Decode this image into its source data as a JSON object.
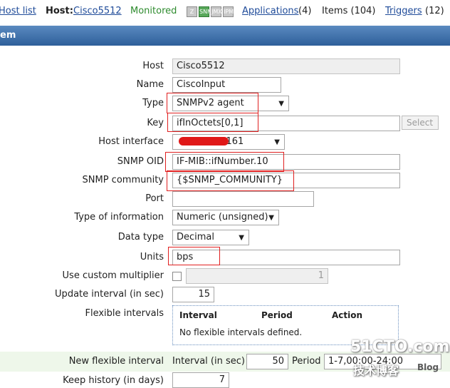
{
  "nav": {
    "host_list": "Host list",
    "host_label": "Host:",
    "host_name": "Cisco5512",
    "status": "Monitored",
    "status_icons": [
      "Z",
      "SNMP",
      "JMX",
      "IPMI"
    ],
    "applications_label": "Applications",
    "applications_count": "(4)",
    "items_label": "Items (104)",
    "triggers_label": "Triggers",
    "triggers_count": "(12)"
  },
  "title": "em",
  "form": {
    "host": {
      "label": "Host",
      "value": "Cisco5512"
    },
    "name": {
      "label": "Name",
      "value": "CiscoInput"
    },
    "type": {
      "label": "Type",
      "value": "SNMPv2 agent"
    },
    "key": {
      "label": "Key",
      "value": "ifInOctets[0,1]",
      "select_button": "Select"
    },
    "host_interface": {
      "label": "Host interface",
      "value": ": 161"
    },
    "snmp_oid": {
      "label": "SNMP OID",
      "value": "IF-MIB::ifNumber.10"
    },
    "snmp_community": {
      "label": "SNMP community",
      "value": "{$SNMP_COMMUNITY}"
    },
    "port": {
      "label": "Port",
      "value": ""
    },
    "type_of_information": {
      "label": "Type of information",
      "value": "Numeric (unsigned)"
    },
    "data_type": {
      "label": "Data type",
      "value": "Decimal"
    },
    "units": {
      "label": "Units",
      "value": "bps"
    },
    "custom_multiplier": {
      "label": "Use custom multiplier",
      "value": "1"
    },
    "update_interval": {
      "label": "Update interval (in sec)",
      "value": "15"
    },
    "flexible_intervals": {
      "label": "Flexible intervals",
      "columns": [
        "Interval",
        "Period",
        "Action"
      ],
      "empty_message": "No flexible intervals defined."
    },
    "new_flexible_interval": {
      "label": "New flexible interval",
      "interval_label": "Interval (in sec)",
      "interval_value": "50",
      "period_label": "Period",
      "period_value": "1-7,00:00-24:00"
    },
    "keep_history": {
      "label": "Keep history (in days)",
      "value": "7"
    }
  },
  "watermark": {
    "line1": "51CTO.com",
    "line2": "技术博客",
    "line3": "Blog"
  },
  "colors": {
    "highlight": "#e02020",
    "title_bar": "#3a6aa6",
    "status_ok": "#2e8b2e"
  }
}
